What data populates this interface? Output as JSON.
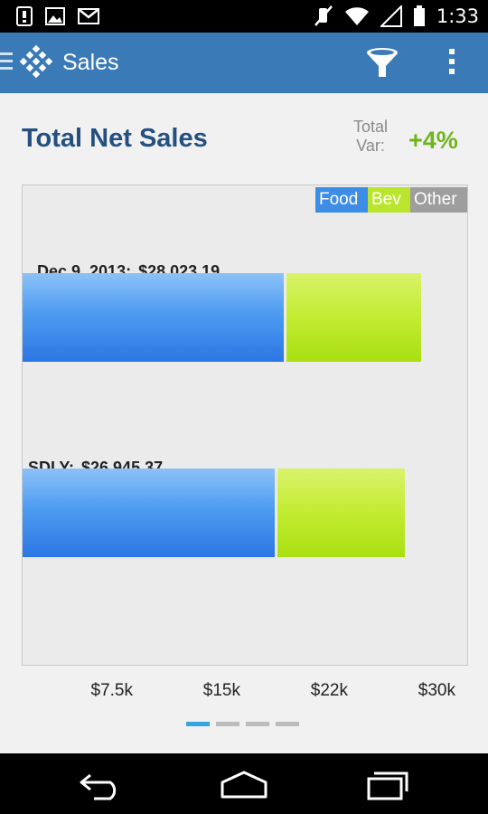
{
  "status_bar": {
    "time": "1:33",
    "left_icons": [
      "notification-icon",
      "image-icon",
      "gmail-icon"
    ],
    "right_icons": [
      "mute-icon",
      "wifi-icon",
      "signal-icon",
      "battery-icon"
    ]
  },
  "action_bar": {
    "title": "Sales",
    "icons": [
      "drawer-icon",
      "app-logo-icon",
      "filter-icon",
      "overflow-menu-icon"
    ]
  },
  "header": {
    "title": "Total Net Sales",
    "variance_label": "Total Var:",
    "variance_value": "+4%"
  },
  "legend": {
    "food": "Food",
    "bev": "Bev",
    "other": "Other"
  },
  "colors": {
    "action_bar": "#3a7ab7",
    "food": "#3d8ce6",
    "bev": "#b9e52d",
    "other": "#9e9e9e",
    "title": "#24507f",
    "variance": "#6fb51e",
    "pager_active": "#33a6e0"
  },
  "chart_data": {
    "type": "bar",
    "orientation": "horizontal",
    "stacked": true,
    "categories": [
      "Dec 9, 2013:",
      "SDLY:"
    ],
    "category_totals": [
      "$28,023.19",
      "$26,945.37"
    ],
    "series": [
      {
        "name": "Food",
        "values": [
          18500,
          17900
        ]
      },
      {
        "name": "Bev",
        "values": [
          9523.19,
          9045.37
        ]
      },
      {
        "name": "Other",
        "values": [
          0,
          0
        ]
      }
    ],
    "x_ticks": [
      "$7.5k",
      "$15k",
      "$22k",
      "$30k"
    ],
    "xlim": [
      0,
      30000
    ],
    "legend_position": "top-right"
  },
  "pager": {
    "page_count": 4,
    "active_index": 0
  },
  "nav_bar": {
    "buttons": [
      "back-icon",
      "home-icon",
      "recent-apps-icon"
    ]
  }
}
